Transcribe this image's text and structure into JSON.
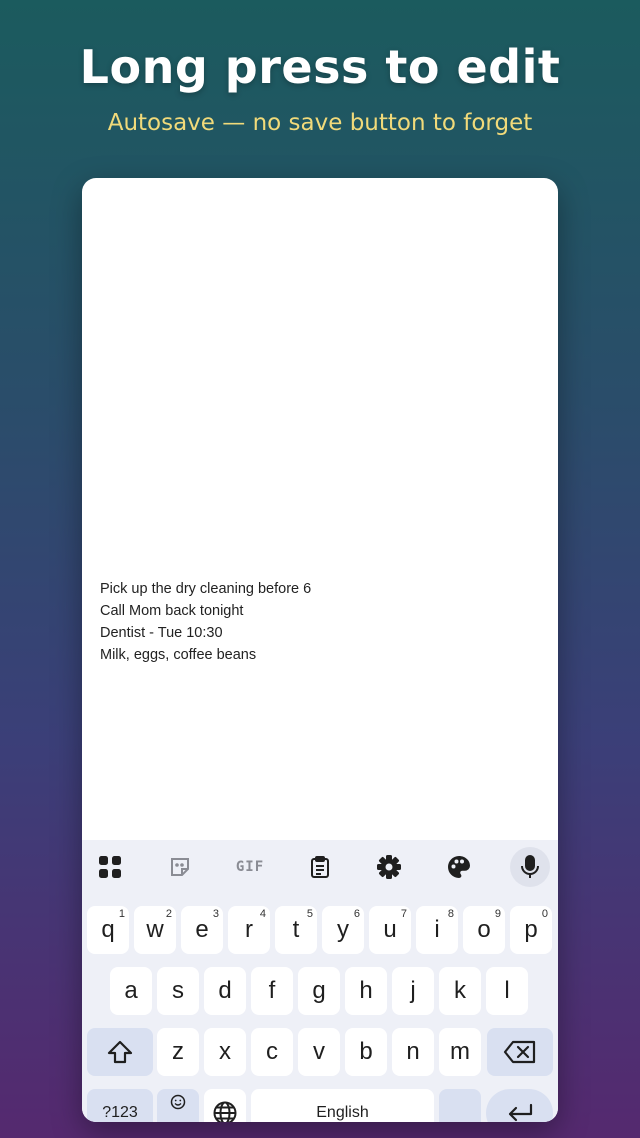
{
  "header": {
    "title": "Long press to edit",
    "subtitle": "Autosave — no save button to forget"
  },
  "note": {
    "lines": [
      "Pick up the dry cleaning before 6",
      "Call Mom back tonight",
      "Dentist - Tue 10:30",
      "Milk, eggs, coffee beans"
    ]
  },
  "keyboard": {
    "toolbar": {
      "items": [
        "apps-icon",
        "sticker-icon",
        "gif-icon",
        "clipboard-icon",
        "gear-icon",
        "palette-icon",
        "mic-icon"
      ],
      "gif_label": "GIF"
    },
    "row1": [
      {
        "key": "q",
        "hint": "1"
      },
      {
        "key": "w",
        "hint": "2"
      },
      {
        "key": "e",
        "hint": "3"
      },
      {
        "key": "r",
        "hint": "4"
      },
      {
        "key": "t",
        "hint": "5"
      },
      {
        "key": "y",
        "hint": "6"
      },
      {
        "key": "u",
        "hint": "7"
      },
      {
        "key": "i",
        "hint": "8"
      },
      {
        "key": "o",
        "hint": "9"
      },
      {
        "key": "p",
        "hint": "0"
      }
    ],
    "row2": [
      "a",
      "s",
      "d",
      "f",
      "g",
      "h",
      "j",
      "k",
      "l"
    ],
    "row3": [
      "z",
      "x",
      "c",
      "v",
      "b",
      "n",
      "m"
    ],
    "bottom": {
      "symbols_label": "?123",
      "space_label": "English"
    }
  },
  "colors": {
    "accent_yellow": "#f1da7a",
    "key_fn": "#d9e0f1",
    "keyboard_bg": "#eef0f7"
  }
}
